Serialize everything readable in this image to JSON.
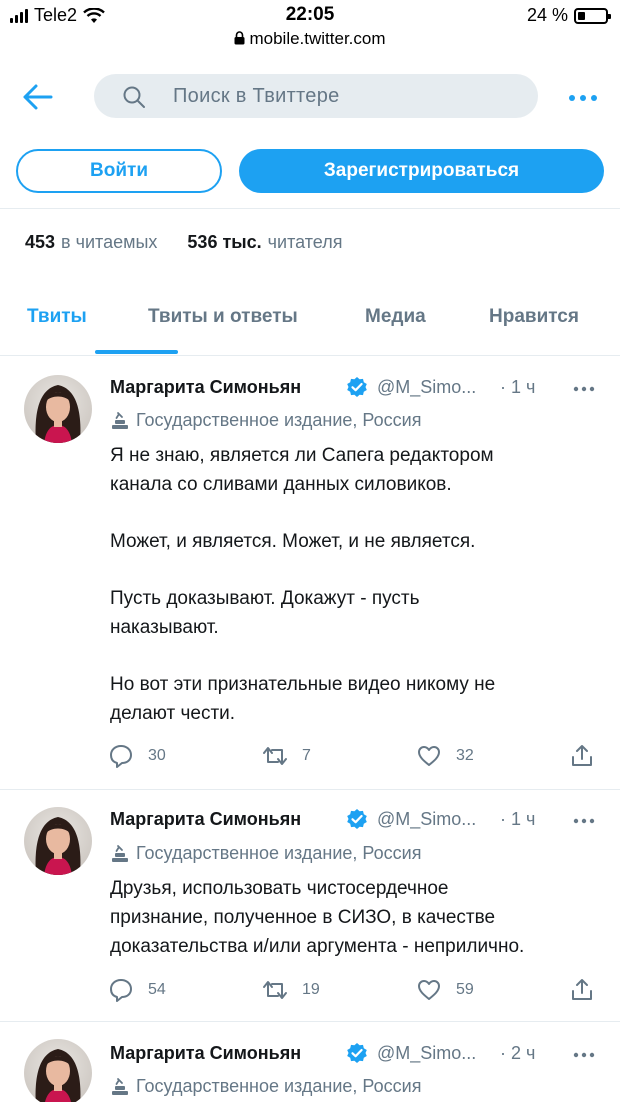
{
  "status_bar": {
    "carrier": "Tele2",
    "time": "22:05",
    "battery": "24 %",
    "battery_level": 0.24
  },
  "url": "mobile.twitter.com",
  "nav": {
    "search_placeholder": "Поиск в Твиттере"
  },
  "auth": {
    "login_label": "Войти",
    "signup_label": "Зарегистрироваться"
  },
  "stats": {
    "following_count": "453",
    "following_label": "в читаемых",
    "followers_count": "536 тыс.",
    "followers_label": "читателя"
  },
  "tabs": [
    {
      "label": "Твиты",
      "active": true
    },
    {
      "label": "Твиты и ответы",
      "active": false
    },
    {
      "label": "Медиа",
      "active": false
    },
    {
      "label": "Нравится",
      "active": false
    }
  ],
  "tweets": [
    {
      "name": "Маргарита Симоньян",
      "handle": "@M_Simo...",
      "time": "· 1 ч",
      "label": "Государственное издание, Россия",
      "paragraphs": [
        "Я не знаю, является ли Сапега редактором\nканала со сливами данных силовиков.",
        "Может, и является. Может, и не является.",
        "Пусть доказывают. Докажут - пусть\nнаказывают.",
        "Но вот эти признательные видео никому не\nделают чести."
      ],
      "replies": "30",
      "retweets": "7",
      "likes": "32"
    },
    {
      "name": "Маргарита Симоньян",
      "handle": "@M_Simo...",
      "time": "· 1 ч",
      "label": "Государственное издание, Россия",
      "paragraphs": [
        "Друзья, использовать чистосердечное\nпризнание, полученное в СИЗО, в качестве\nдоказательства и/или аргумента - неприлично."
      ],
      "replies": "54",
      "retweets": "19",
      "likes": "59"
    },
    {
      "name": "Маргарита Симоньян",
      "handle": "@M_Simo...",
      "time": "· 2 ч",
      "label": "Государственное издание, Россия",
      "paragraphs": []
    }
  ],
  "colors": {
    "accent": "#1da1f2",
    "secondary_text": "#657786",
    "border": "#e6ecf0",
    "search_bg": "#e6ecf0"
  }
}
